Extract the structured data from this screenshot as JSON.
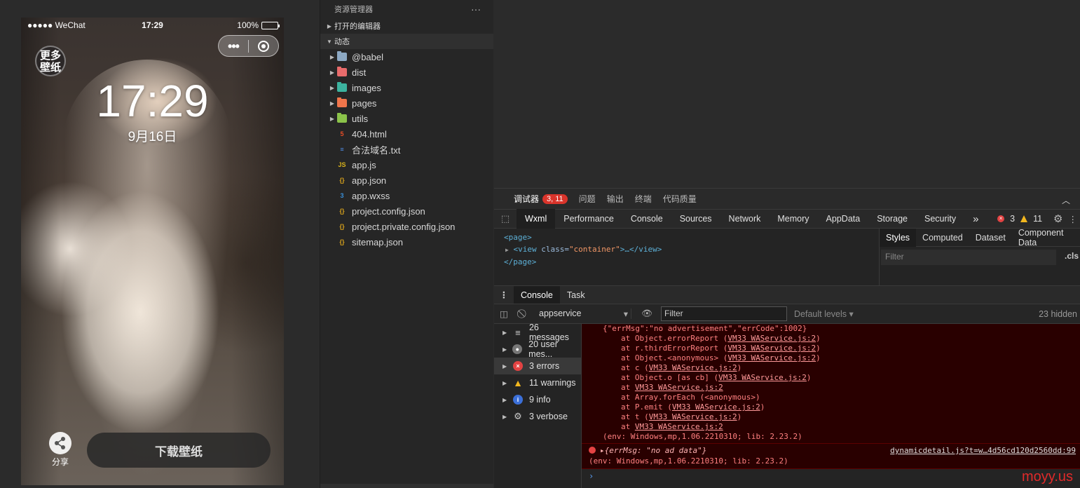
{
  "simulator": {
    "carrier": "●●●●● WeChat",
    "status_time": "17:29",
    "battery": "100%",
    "logo_text": "更多\n壁纸",
    "clock": "17:29",
    "date": "9月16日",
    "share_label": "分享",
    "download_label": "下载壁纸"
  },
  "explorer": {
    "title": "资源管理器",
    "more": "···",
    "open_editors": "打开的编辑器",
    "project": "动态",
    "items": [
      {
        "name": "@babel",
        "type": "folder",
        "color": "#8da9c4"
      },
      {
        "name": "dist",
        "type": "folder",
        "color": "#e86b6b"
      },
      {
        "name": "images",
        "type": "folder",
        "color": "#3cb39f"
      },
      {
        "name": "pages",
        "type": "folder",
        "color": "#f0754b"
      },
      {
        "name": "utils",
        "type": "folder",
        "color": "#8bc34a"
      },
      {
        "name": "404.html",
        "type": "file",
        "color": "#e44d26",
        "glyph": "5"
      },
      {
        "name": "合法域名.txt",
        "type": "file",
        "color": "#4f8ee8",
        "glyph": "≡"
      },
      {
        "name": "app.js",
        "type": "file",
        "color": "#d8b21c",
        "glyph": "JS"
      },
      {
        "name": "app.json",
        "type": "file",
        "color": "#d8a21c",
        "glyph": "{}"
      },
      {
        "name": "app.wxss",
        "type": "file",
        "color": "#3a8fd8",
        "glyph": "3"
      },
      {
        "name": "project.config.json",
        "type": "file",
        "color": "#d8a21c",
        "glyph": "{}"
      },
      {
        "name": "project.private.config.json",
        "type": "file",
        "color": "#d8a21c",
        "glyph": "{}"
      },
      {
        "name": "sitemap.json",
        "type": "file",
        "color": "#d8a21c",
        "glyph": "{}"
      }
    ]
  },
  "debugger": {
    "tabs": [
      {
        "label": "调试器",
        "badge": "3, 11",
        "active": true
      },
      {
        "label": "问题"
      },
      {
        "label": "输出"
      },
      {
        "label": "终端"
      },
      {
        "label": "代码质量"
      }
    ],
    "devtools_tabs": [
      "Wxml",
      "Performance",
      "Console",
      "Sources",
      "Network",
      "Memory",
      "AppData",
      "Storage",
      "Security"
    ],
    "more_tabs": "»",
    "error_count": "3",
    "warning_count": "11",
    "wxml": {
      "line1": "<page>",
      "line2_tag": "<view",
      "line2_attr": " class=",
      "line2_val": "\"container\"",
      "line2_rest": ">…</view>",
      "line3": "</page>"
    },
    "styles_tabs": [
      "Styles",
      "Computed",
      "Dataset",
      "Component Data"
    ],
    "styles_filter_placeholder": "Filter",
    "cls": ".cls",
    "drawer_tabs": [
      "Console",
      "Task"
    ],
    "context": "appservice",
    "filter_placeholder": "Filter",
    "levels": "Default levels ▾",
    "hidden": "23 hidden",
    "sidebar": [
      {
        "label": "26 messages",
        "icon": "list",
        "color": "#555"
      },
      {
        "label": "20 user mes...",
        "icon": "user",
        "color": "#777"
      },
      {
        "label": "3 errors",
        "icon": "error",
        "color": "#e34343"
      },
      {
        "label": "11 warnings",
        "icon": "warn",
        "color": "#f2b71e"
      },
      {
        "label": "9 info",
        "icon": "info",
        "color": "#3b6fd8"
      },
      {
        "label": "3 verbose",
        "icon": "gear",
        "color": "#888"
      }
    ],
    "error1_head": "{\"errMsg\":\"no advertisement\",\"errCode\":1002}",
    "stack": [
      {
        "pre": "at Object.errorReport (",
        "link": "VM33 WAService.js:2",
        "post": ")"
      },
      {
        "pre": "at r.thirdErrorReport (",
        "link": "VM33 WAService.js:2",
        "post": ")"
      },
      {
        "pre": "at Object.<anonymous> (",
        "link": "VM33 WAService.js:2",
        "post": ")"
      },
      {
        "pre": "at c (",
        "link": "VM33 WAService.js:2",
        "post": ")"
      },
      {
        "pre": "at Object.o [as cb] (",
        "link": "VM33 WAService.js:2",
        "post": ")"
      },
      {
        "pre": "at ",
        "link": "VM33 WAService.js:2",
        "post": ""
      },
      {
        "pre": "at Array.forEach (<anonymous>)",
        "link": "",
        "post": ""
      },
      {
        "pre": "at P.emit (",
        "link": "VM33 WAService.js:2",
        "post": ")"
      },
      {
        "pre": "at t (",
        "link": "VM33 WAService.js:2",
        "post": ")"
      },
      {
        "pre": "at ",
        "link": "VM33 WAService.js:2",
        "post": ""
      }
    ],
    "error1_env": "(env: Windows,mp,1.06.2210310; lib: 2.23.2)",
    "error2_text": "▸{errMsg: \"no ad data\"}",
    "error2_link": "dynamicdetail.js?t=w…4d56cd120d2560dd:99",
    "error2_env": "(env: Windows,mp,1.06.2210310; lib: 2.23.2)",
    "prompt": "›"
  },
  "watermark": "moyy.us"
}
